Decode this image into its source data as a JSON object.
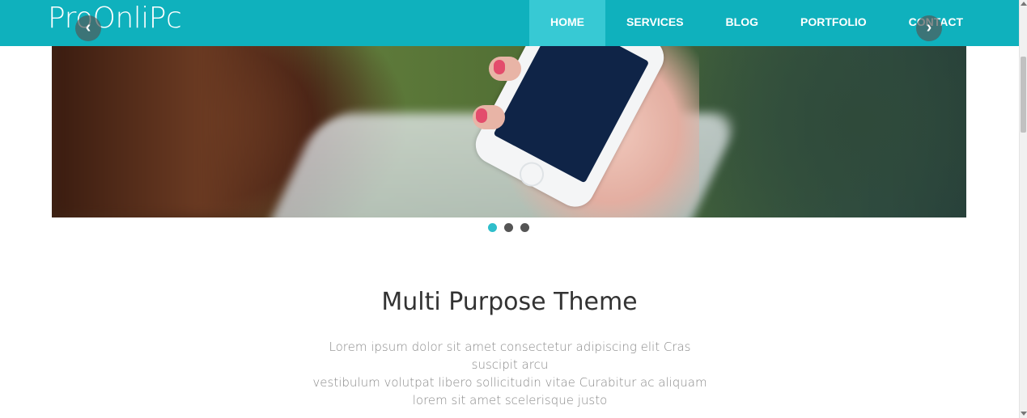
{
  "header": {
    "brand": "ProOnliPc",
    "nav": [
      {
        "label": "HOME",
        "active": true
      },
      {
        "label": "SERVICES",
        "active": false
      },
      {
        "label": "BLOG",
        "active": false
      },
      {
        "label": "PORTFOLIO",
        "active": false
      },
      {
        "label": "CONTACT",
        "active": false
      }
    ],
    "color": "#0fb1bd",
    "active_color": "#37c9d4"
  },
  "slider": {
    "prev_icon": "chevron-left-icon",
    "next_icon": "chevron-right-icon",
    "prev_glyph": "‹",
    "next_glyph": "›",
    "image_subject": "hand holding smartphone",
    "slide_count": 3,
    "active_slide": 1,
    "active_dot_color": "#2fbecb"
  },
  "intro": {
    "title": "Multi Purpose Theme",
    "text_line1": "Lorem ipsum dolor sit amet consectetur adipiscing elit Cras suscipit arcu",
    "text_line2": "vestibulum volutpat libero sollicitudin vitae Curabitur ac aliquam",
    "text_line3": "lorem sit amet scelerisque justo"
  }
}
